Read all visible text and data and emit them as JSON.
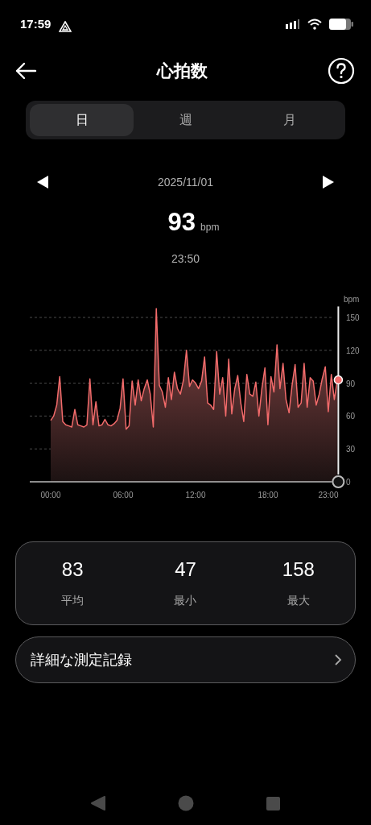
{
  "status_bar": {
    "time": "17:59"
  },
  "header": {
    "title": "心拍数"
  },
  "tabs": [
    {
      "label": "日",
      "selected": true
    },
    {
      "label": "週",
      "selected": false
    },
    {
      "label": "月",
      "selected": false
    }
  ],
  "date_nav": {
    "date": "2025/11/01"
  },
  "reading": {
    "value": "93",
    "unit": "bpm",
    "time": "23:50"
  },
  "chart": {
    "chart_data": {
      "type": "area",
      "ylabel": "bpm",
      "xlim": [
        -1.73,
        23.83
      ],
      "ylim": [
        0,
        160
      ],
      "grid": true,
      "xticks": [
        {
          "value": 0,
          "label": "00:00"
        },
        {
          "value": 6,
          "label": "06:00"
        },
        {
          "value": 12,
          "label": "12:00"
        },
        {
          "value": 18,
          "label": "18:00"
        },
        {
          "value": 23,
          "label": "23:00"
        }
      ],
      "yticks": [
        0,
        30,
        60,
        90,
        120,
        150
      ],
      "x": [
        0,
        0.25,
        0.5,
        0.75,
        1,
        1.25,
        1.5,
        1.75,
        2,
        2.25,
        2.5,
        2.75,
        3,
        3.25,
        3.5,
        3.75,
        4,
        4.25,
        4.5,
        4.75,
        5,
        5.25,
        5.5,
        5.75,
        6,
        6.25,
        6.5,
        6.75,
        7,
        7.25,
        7.5,
        7.75,
        8,
        8.25,
        8.5,
        8.75,
        9,
        9.25,
        9.5,
        9.75,
        10,
        10.25,
        10.5,
        10.75,
        11,
        11.25,
        11.5,
        11.75,
        12,
        12.25,
        12.5,
        12.75,
        13,
        13.25,
        13.5,
        13.75,
        14,
        14.25,
        14.5,
        14.75,
        15,
        15.25,
        15.5,
        15.75,
        16,
        16.25,
        16.5,
        16.75,
        17,
        17.25,
        17.5,
        17.75,
        18,
        18.25,
        18.5,
        18.75,
        19,
        19.25,
        19.5,
        19.75,
        20,
        20.25,
        20.5,
        20.75,
        21,
        21.25,
        21.5,
        21.75,
        22,
        22.25,
        22.5,
        22.75,
        23,
        23.25,
        23.5,
        23.75
      ],
      "values": [
        56,
        60,
        70,
        96,
        55,
        52,
        51,
        50,
        66,
        52,
        51,
        50,
        52,
        94,
        52,
        73,
        51,
        52,
        57,
        52,
        51,
        53,
        56,
        67,
        94,
        48,
        51,
        92,
        70,
        93,
        74,
        85,
        93,
        80,
        50,
        158,
        88,
        82,
        68,
        95,
        75,
        100,
        85,
        80,
        93,
        120,
        87,
        93,
        90,
        85,
        92,
        114,
        72,
        70,
        66,
        119,
        80,
        95,
        60,
        112,
        62,
        85,
        97,
        72,
        55,
        98,
        80,
        78,
        91,
        60,
        85,
        104,
        52,
        96,
        82,
        125,
        85,
        108,
        75,
        63,
        88,
        107,
        68,
        72,
        108,
        68,
        95,
        92,
        70,
        80,
        94,
        105,
        64,
        98,
        75,
        93
      ]
    }
  },
  "stats": [
    {
      "value": "83",
      "label": "平均"
    },
    {
      "value": "47",
      "label": "最小"
    },
    {
      "value": "158",
      "label": "最大"
    }
  ],
  "detail_link": {
    "label": "詳細な測定記録"
  }
}
